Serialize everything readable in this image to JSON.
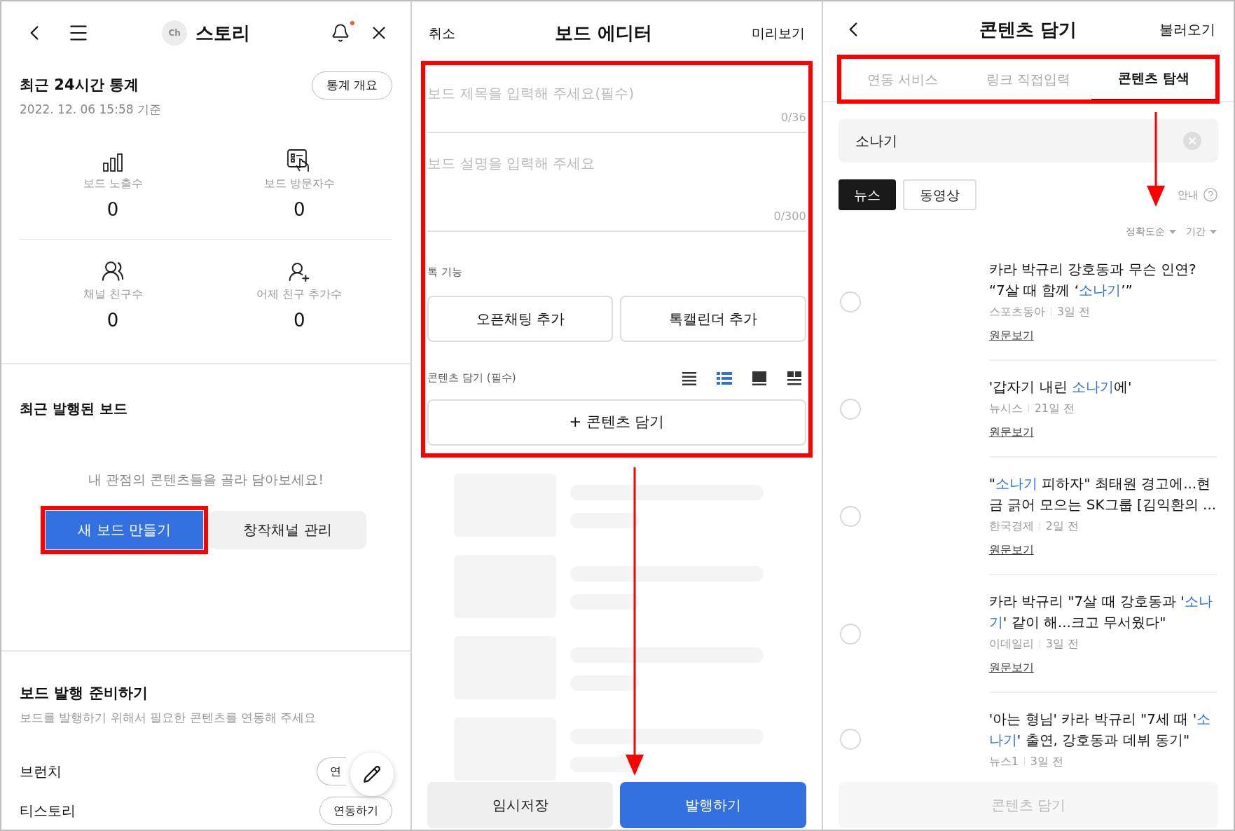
{
  "stats_screen": {
    "header": {
      "logo_text": "Ch",
      "title": "스토리",
      "notification_dot": true
    },
    "stats": {
      "title": "최근 24시간 통계",
      "button": "통계 개요",
      "timestamp": "2022. 12. 06 15:58 기준",
      "items": [
        {
          "label": "보드 노출수",
          "value": "0"
        },
        {
          "label": "보드 방문자수",
          "value": "0"
        },
        {
          "label": "채널 친구수",
          "value": "0"
        },
        {
          "label": "어제 친구 추가수",
          "value": "0"
        }
      ]
    },
    "recent": {
      "title": "최근 발행된 보드",
      "message": "내 관점의 콘텐츠들을 골라 담아보세요!",
      "buttons": [
        {
          "label": "새 보드 만들기",
          "kind": "primary",
          "highlighted": true
        },
        {
          "label": "창작채널 관리",
          "kind": "secondary",
          "highlighted": false
        }
      ]
    },
    "prepare": {
      "title": "보드 발행 준비하기",
      "subtitle": "보드를 발행하기 위해서 필요한 콘텐츠를 연동해 주세요",
      "rows": [
        {
          "name": "브런치",
          "button": "연",
          "kind": "partial"
        },
        {
          "name": "티스토리",
          "button": "연동하기",
          "kind": "full"
        }
      ]
    }
  },
  "editor_screen": {
    "header": {
      "left": "취소",
      "title": "보드 에디터",
      "right": "미리보기"
    },
    "form": {
      "highlighted": true,
      "title_field": {
        "placeholder": "보드 제목을 입력해 주세요(필수)",
        "counter": "0/36"
      },
      "description_field": {
        "placeholder": "보드 설명을 입력해 주세요",
        "counter": "0/300"
      },
      "talk_label": "톡 기능",
      "talk_buttons": [
        "오픈채팅 추가",
        "톡캘린더 추가"
      ],
      "content_label": "콘텐츠 담기 (필수)",
      "layouts": [
        {
          "selected": false
        },
        {
          "selected": true
        },
        {
          "selected": false
        },
        {
          "selected": false
        }
      ],
      "add_button": "+ 콘텐츠 담기"
    },
    "placeholders": [
      {
        "kind": "skeleton"
      },
      {
        "kind": "skeleton"
      },
      {
        "kind": "skeleton"
      },
      {
        "kind": "skeleton"
      }
    ],
    "footer": [
      {
        "label": "임시저장",
        "kind": "secondary"
      },
      {
        "label": "발행하기",
        "kind": "primary"
      }
    ]
  },
  "content_screen": {
    "header": {
      "title": "콘텐츠 담기",
      "right": "불러오기"
    },
    "tabs_highlighted": true,
    "tabs": [
      {
        "label": "연동 서비스",
        "selected": false
      },
      {
        "label": "링크 직접입력",
        "selected": false
      },
      {
        "label": "콘텐츠 탐색",
        "selected": true
      }
    ],
    "search": {
      "value": "소나기"
    },
    "chips": [
      {
        "label": "뉴스",
        "selected": true
      },
      {
        "label": "동영상",
        "selected": false
      }
    ],
    "help": "안내",
    "sorts": [
      "정확도순",
      "기간"
    ],
    "results": [
      {
        "selected": false,
        "title": [
          {
            "text": "카라 박규리 강호동과 무슨 인연? “7살 때 함께 ‘",
            "highlight": false
          },
          {
            "text": "소나기",
            "highlight": true
          },
          {
            "text": "’”",
            "highlight": false
          }
        ],
        "source": "스포츠동아",
        "age": "3일 전",
        "link": "원문보기"
      },
      {
        "selected": false,
        "title": [
          {
            "text": "'갑자기 내린 ",
            "highlight": false
          },
          {
            "text": "소나기",
            "highlight": true
          },
          {
            "text": "에'",
            "highlight": false
          }
        ],
        "source": "뉴시스",
        "age": "21일 전",
        "link": "원문보기"
      },
      {
        "selected": false,
        "title": [
          {
            "text": "\"",
            "highlight": false
          },
          {
            "text": "소나기",
            "highlight": true
          },
          {
            "text": " 피하자\" 최태원 경고에...현금 긁어 모으는 SK그룹 [김익환의 ...",
            "highlight": false
          }
        ],
        "source": "한국경제",
        "age": "2일 전",
        "link": "원문보기"
      },
      {
        "selected": false,
        "title": [
          {
            "text": "카라 박규리 \"7살 때 강호동과 '",
            "highlight": false
          },
          {
            "text": "소나기",
            "highlight": true
          },
          {
            "text": "' 같이 해...크고 무서웠다\"",
            "highlight": false
          }
        ],
        "source": "이데일리",
        "age": "3일 전",
        "link": "원문보기"
      },
      {
        "selected": false,
        "title": [
          {
            "text": "'아는 형님' 카라 박규리 \"7세 때 '",
            "highlight": false
          },
          {
            "text": "소나기",
            "highlight": true
          },
          {
            "text": "' 출연, 강호동과 데뷔 동기\"",
            "highlight": false
          }
        ],
        "source": "뉴스1",
        "age": "3일 전"
      }
    ],
    "submit": {
      "label": "콘텐츠 담기",
      "disabled": true
    }
  }
}
